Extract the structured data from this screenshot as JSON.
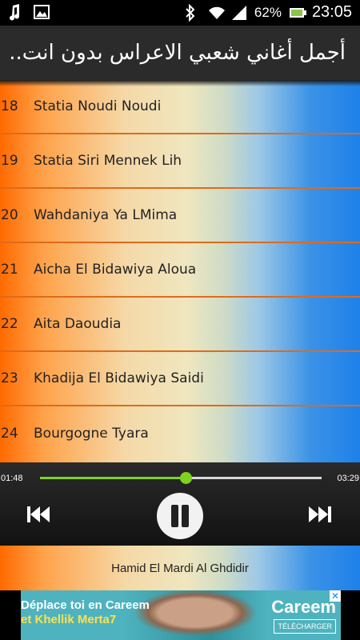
{
  "status_bar": {
    "left_icons": [
      "music-note-icon",
      "image-icon"
    ],
    "right_icons": [
      "bluetooth-icon",
      "wifi-icon",
      "signal-icon",
      "battery-icon"
    ],
    "battery_percent": "62%",
    "clock": "23:05"
  },
  "header": {
    "title": "أجمل أغاني شعبي الاعراس بدون انت.."
  },
  "tracks": [
    {
      "number": "18",
      "title": "Statia Noudi Noudi"
    },
    {
      "number": "19",
      "title": "Statia Siri Mennek Lih"
    },
    {
      "number": "20",
      "title": "Wahdaniya Ya LMima"
    },
    {
      "number": "21",
      "title": "Aicha El Bidawiya Aloua"
    },
    {
      "number": "22",
      "title": "Aita Daoudia"
    },
    {
      "number": "23",
      "title": "Khadija El Bidawiya Saidi"
    },
    {
      "number": "24",
      "title": "Bourgogne Tyara"
    }
  ],
  "player": {
    "current_time": "01:48",
    "duration": "03:29",
    "progress_fraction": 0.517,
    "accent_color": "#7ed321"
  },
  "now_playing": {
    "title": "Hamid El Mardi Al Ghdidir"
  },
  "ad": {
    "line1": "Déplace toi en Careem",
    "line2": "et Khellik Merta7",
    "brand": "Careem",
    "cta": "TÉLÉCHARGER"
  }
}
